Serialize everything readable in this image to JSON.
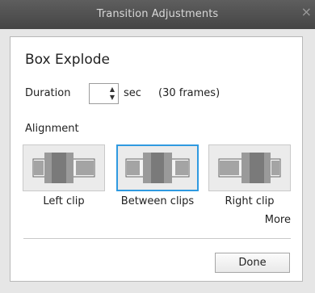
{
  "window": {
    "title": "Transition Adjustments",
    "close_glyph": "×"
  },
  "panel": {
    "heading": "Box Explode",
    "duration": {
      "label": "Duration",
      "value": "",
      "unit": "sec",
      "frames_text": "(30 frames)"
    },
    "alignment": {
      "label": "Alignment",
      "options": [
        {
          "label": "Left clip",
          "icon": "align-left-clip-icon",
          "selected": false
        },
        {
          "label": "Between clips",
          "icon": "align-between-clips-icon",
          "selected": true
        },
        {
          "label": "Right clip",
          "icon": "align-right-clip-icon",
          "selected": false
        }
      ]
    },
    "more_label": "More",
    "done_label": "Done"
  },
  "colors": {
    "titlebar": "#4f4f4f",
    "selection_border": "#2f9ae0",
    "panel_bg": "#ffffff",
    "dialog_bg": "#e6e6e6"
  }
}
